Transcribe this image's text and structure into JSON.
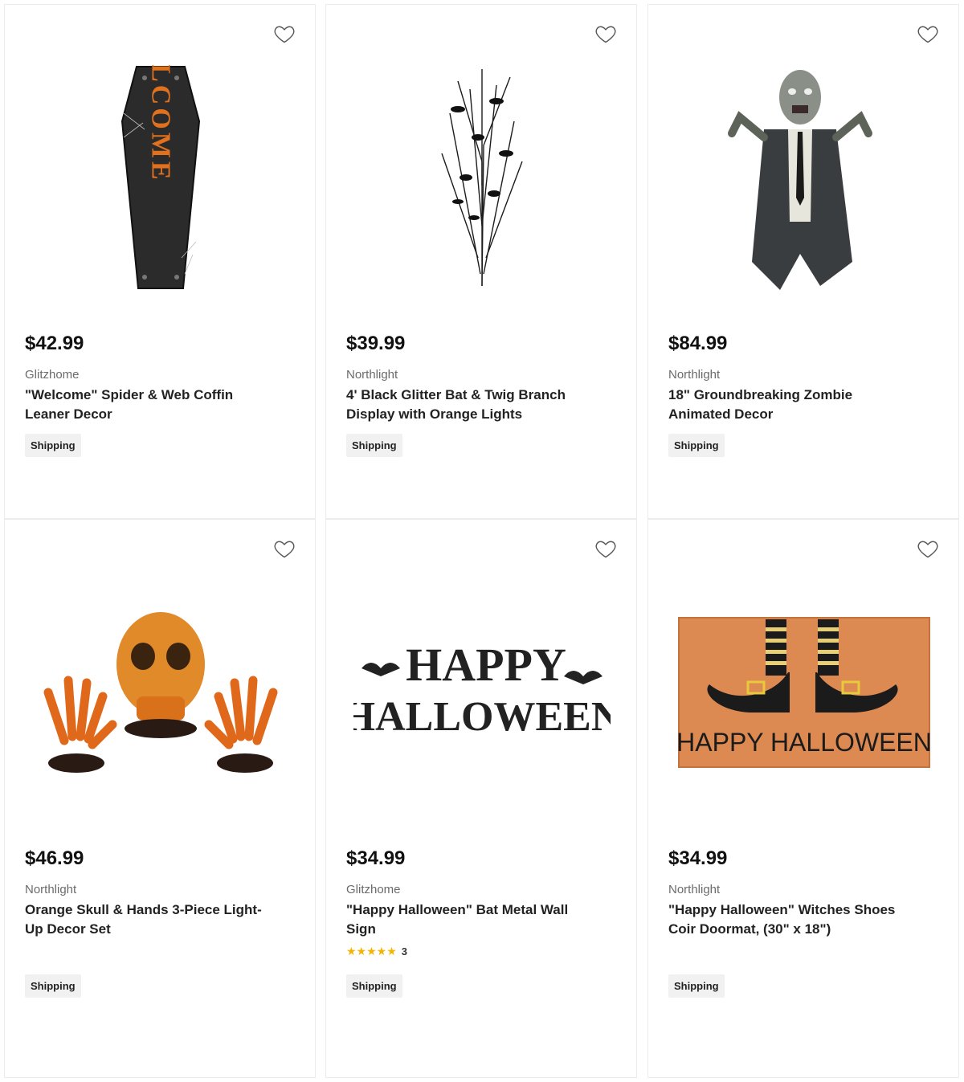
{
  "products": [
    {
      "price": "$42.99",
      "brand": "Glitzhome",
      "title": "\"Welcome\" Spider & Web Coffin Leaner Decor",
      "badge": "Shipping",
      "image": "coffin-welcome-sign",
      "favorite_icon": "heart-outline-icon"
    },
    {
      "price": "$39.99",
      "brand": "Northlight",
      "title": "4' Black Glitter Bat & Twig Branch Display with Orange Lights",
      "badge": "Shipping",
      "image": "bat-twig-branch",
      "favorite_icon": "heart-outline-icon"
    },
    {
      "price": "$84.99",
      "brand": "Northlight",
      "title": "18\" Groundbreaking Zombie Animated Decor",
      "badge": "Shipping",
      "image": "zombie-figure",
      "favorite_icon": "heart-outline-icon"
    },
    {
      "price": "$46.99",
      "brand": "Northlight",
      "title": "Orange Skull & Hands 3-Piece Light-Up Decor Set",
      "badge": "Shipping",
      "image": "orange-skull-hands",
      "favorite_icon": "heart-outline-icon"
    },
    {
      "price": "$34.99",
      "brand": "Glitzhome",
      "title": "\"Happy Halloween\" Bat Metal Wall Sign",
      "badge": "Shipping",
      "image": "happy-halloween-bat-sign",
      "rating": {
        "stars": 5,
        "count": "3"
      },
      "favorite_icon": "heart-outline-icon"
    },
    {
      "price": "$34.99",
      "brand": "Northlight",
      "title": "\"Happy Halloween\" Witches Shoes Coir Doormat, (30\" x 18\")",
      "badge": "Shipping",
      "image": "witch-shoes-doormat",
      "favorite_icon": "heart-outline-icon"
    }
  ],
  "doormat_text": "HAPPY HALLOWEEN",
  "sign_text_top": "HAPPY",
  "sign_text_bottom": "HALLOWEEN",
  "coffin_text": "WELCOME",
  "colors": {
    "star": "#f5b400",
    "badge_bg": "#f1f1f1",
    "orange": "#e2711d"
  }
}
